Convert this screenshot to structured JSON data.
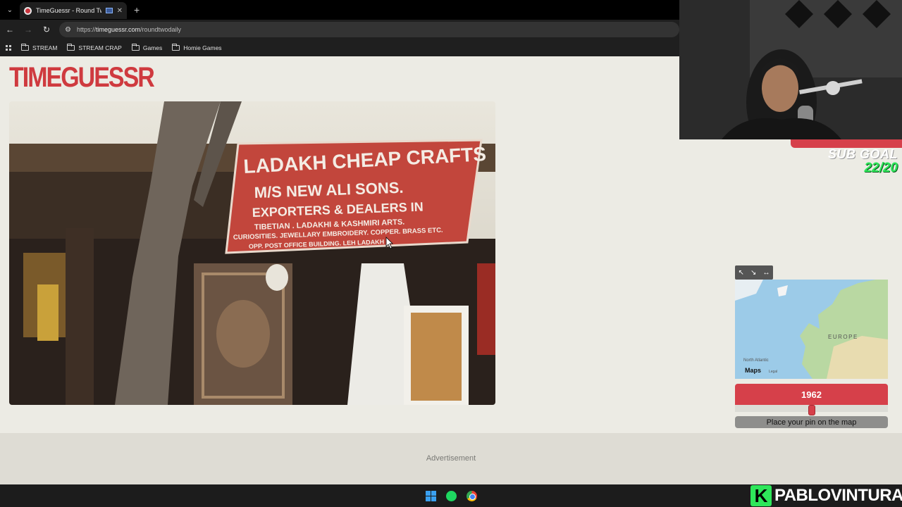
{
  "browser": {
    "tab_title": "TimeGuessr - Round Two",
    "url_prefix": "https://",
    "url_host": "timeguessr.com",
    "url_path": "/roundtwodaily",
    "bookmarks": [
      "STREAM",
      "STREAM CRAP",
      "Games",
      "Homie Games"
    ]
  },
  "page": {
    "logo": "TIMEGUESSR",
    "photo_sign": {
      "line1": "LADAKH CHEAP CRAFTS",
      "line2": "M/S NEW ALI SONS.",
      "line3": "EXPORTERS & DEALERS IN",
      "line4": "TIBETIAN . LADAKHI & KASHMIRI ARTS.",
      "line5": "CURIOSITIES. JEWELLARY EMBROIDERY. COPPER. BRASS ETC.",
      "line6": "OPP. POST OFFICE BUILDING. LEH LADAKH"
    },
    "map": {
      "controls": [
        "↖",
        "↘",
        "↔"
      ],
      "label_region": "EUROPE",
      "label_ocean": "North Atlantic",
      "attribution": "Maps",
      "legal": "Legal"
    },
    "year": "1962",
    "slider_fraction": 0.5,
    "place_pin": "Place your pin on the map",
    "advertisement": "Advertisement"
  },
  "overlay": {
    "subgoal_title": "SUB GOAL",
    "subgoal_count": "22/20",
    "brand_k": "K",
    "brand_name": "PABLOVINTURA"
  },
  "colors": {
    "accent_red": "#d6404a",
    "page_bg": "#ecebe4",
    "sub_green": "#2ee65a"
  }
}
